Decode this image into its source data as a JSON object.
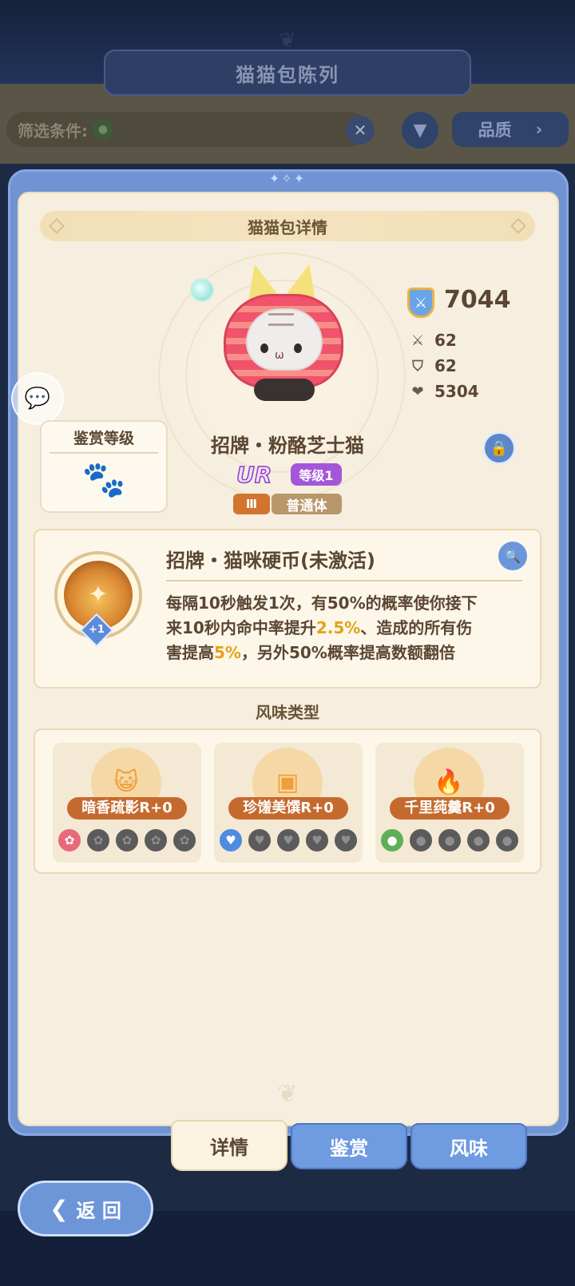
{
  "header": {
    "title": "猫猫包陈列"
  },
  "filter": {
    "label": "筛选条件:",
    "clear_icon": "close-icon",
    "sort_label": "品质"
  },
  "panel": {
    "title": "猫猫包详情"
  },
  "pet": {
    "name": "招牌・粉酪芝士猫",
    "rarity": "UR",
    "level": "等级1",
    "tier": "Ⅲ",
    "body_type": "普通体",
    "power": "7044",
    "attack": "62",
    "defense": "62",
    "hp": "5304"
  },
  "appraisal": {
    "title": "鉴赏等级"
  },
  "skill": {
    "title": "招牌・猫咪硬币(未激活)",
    "badge": "+1",
    "desc_1": "每隔10秒触发1次，有50%的概率使你接下",
    "desc_2a": "来10秒内命中率提升",
    "desc_2b": "2.5%",
    "desc_2c": "、造成的所有伤",
    "desc_3a": "害提高",
    "desc_3b": "5%",
    "desc_3c": "，另外50%概率提高数额翻倍"
  },
  "flavor": {
    "heading": "风味类型",
    "slots": [
      {
        "label": "暗香疏影R+0"
      },
      {
        "label": "珍馐美馔R+0"
      },
      {
        "label": "千里莼羹R+0"
      }
    ]
  },
  "tabs": {
    "detail": "详情",
    "appraise": "鉴赏",
    "flavor": "风味"
  },
  "back": {
    "label": "返 回"
  },
  "colors": {
    "panel_blue": "#6f93d3",
    "card_bg": "#f6efdf",
    "highlight": "#e3a21a",
    "rarity_purple": "#a357d8"
  }
}
